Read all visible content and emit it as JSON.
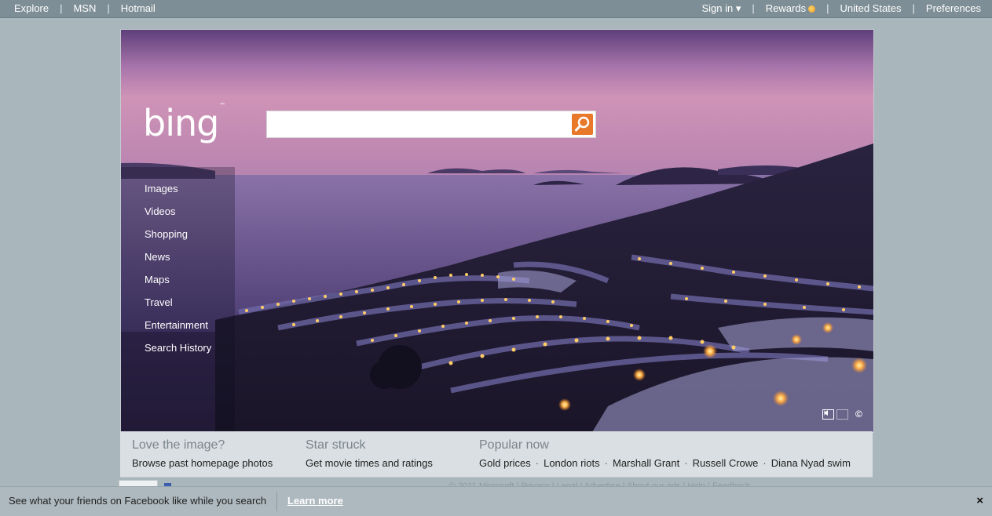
{
  "topbar": {
    "left": [
      "Explore",
      "MSN",
      "Hotmail"
    ],
    "sign_in": "Sign in ▾",
    "rewards": "Rewards",
    "region": "United States",
    "preferences": "Preferences"
  },
  "logo": {
    "text": "bing",
    "tm": "™"
  },
  "search": {
    "value": "",
    "placeholder": ""
  },
  "nav": [
    "Images",
    "Videos",
    "Shopping",
    "News",
    "Maps",
    "Travel",
    "Entertainment",
    "Search History"
  ],
  "hero_controls": {
    "copyright": "©"
  },
  "strip": {
    "col1": {
      "heading": "Love the image?",
      "text": "Browse past homepage photos"
    },
    "col2": {
      "heading": "Star struck",
      "text": "Get movie times and ratings"
    },
    "col3": {
      "heading": "Popular now",
      "items": [
        "Gold prices",
        "London riots",
        "Marshall Grant",
        "Russell Crowe",
        "Diana Nyad swim"
      ]
    }
  },
  "footer_faded": "© 2011 Microsoft | Privacy | Legal | Advertise | About our ads | Help | Feedback",
  "fbbar": {
    "message": "See what your friends on Facebook like while you search",
    "learn_more": "Learn more",
    "close": "×"
  },
  "colors": {
    "accent": "#e8782a",
    "topbar": "#7e8e96",
    "background": "#a9b6bc"
  }
}
